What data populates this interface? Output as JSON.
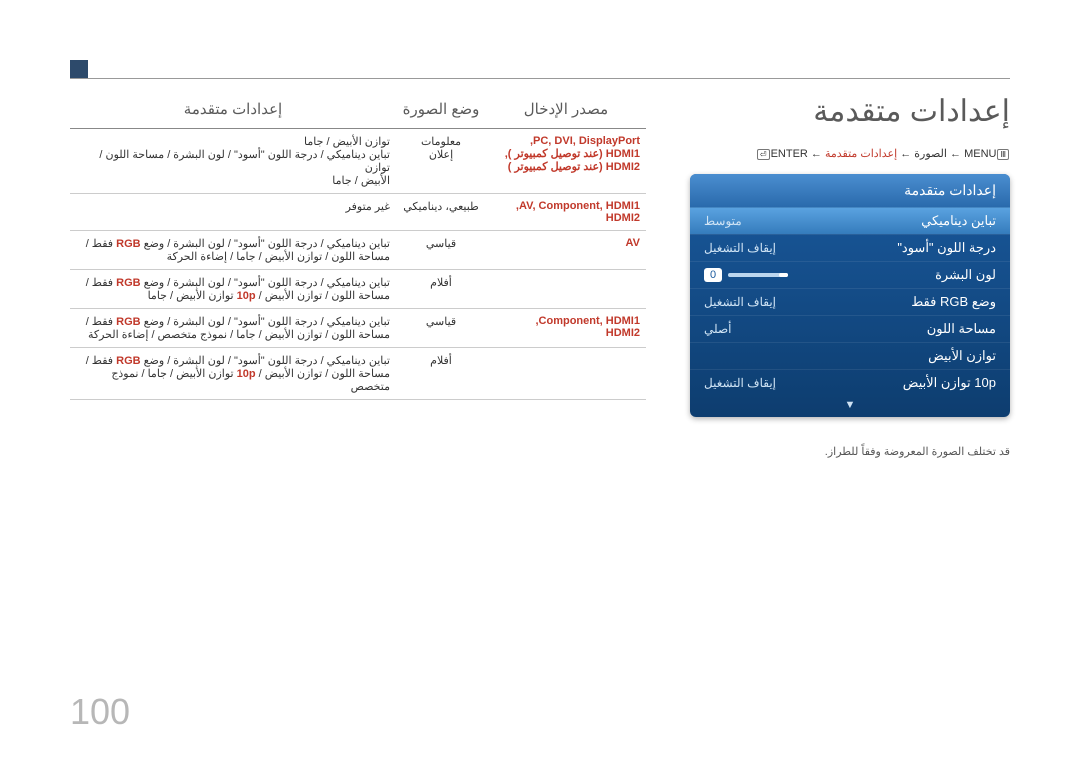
{
  "page_number": "100",
  "page_title": "إعدادات متقدمة",
  "breadcrumb": {
    "menu_label": "MENU",
    "picture_label": "الصورة",
    "advanced_label": "إعدادات متقدمة",
    "enter_label": "ENTER",
    "arrow": "←"
  },
  "osd": {
    "title": "إعدادات متقدمة",
    "rows": [
      {
        "label": "تباين ديناميكي",
        "value": "متوسط",
        "hl": true
      },
      {
        "label": "درجة اللون \"أسود\"",
        "value": "إيقاف التشغيل"
      },
      {
        "label": "لون البشرة",
        "value": "0",
        "slider": true
      },
      {
        "label": "وضع RGB فقط",
        "value": "إيقاف التشغيل"
      },
      {
        "label": "مساحة اللون",
        "value": "أصلي"
      },
      {
        "label": "توازن الأبيض",
        "value": ""
      },
      {
        "label": "10p توازن الأبيض",
        "value": "إيقاف التشغيل"
      }
    ]
  },
  "note": "قد تختلف الصورة المعروضة وفقاً للطراز.",
  "table": {
    "headers": [
      "مصدر الإدخال",
      "وضع الصورة",
      "إعدادات متقدمة"
    ],
    "rows": [
      {
        "source_lines": [
          "PC, DVI, DisplayPort,",
          "HDMI1 (عند توصيل كمبيوتر ),",
          "HDMI2 (عند توصيل كمبيوتر )"
        ],
        "mode_lines": [
          "معلومات",
          "إعلان"
        ],
        "settings_lines": [
          "توازن الأبيض / جاما",
          "تباين ديناميكي / درجة اللون \"أسود\" / لون البشرة / مساحة اللون / توازن",
          "الأبيض / جاما"
        ]
      },
      {
        "source_lines": [
          "AV, Component, HDMI1,",
          "HDMI2"
        ],
        "mode_lines": [
          "طبيعي، ديناميكي"
        ],
        "settings_lines": [
          "غير متوفر"
        ]
      },
      {
        "source_lines": [
          "AV"
        ],
        "mode_lines": [
          "قياسي"
        ],
        "settings_lines": [
          "تباين ديناميكي / درجة اللون \"أسود\" / لون البشرة / وضع RGB فقط / ",
          "مساحة اللون / توازن الأبيض / جاما / إضاءة الحركة"
        ]
      },
      {
        "source_lines": [
          ""
        ],
        "mode_lines": [
          "أفلام"
        ],
        "settings_lines": [
          "تباين ديناميكي / درجة اللون \"أسود\" / لون البشرة / وضع RGB فقط /",
          "مساحة اللون / توازن الأبيض / 10p توازن الأبيض / جاما"
        ]
      },
      {
        "source_lines": [
          "Component, HDMI1,",
          "HDMI2"
        ],
        "mode_lines": [
          "قياسي"
        ],
        "settings_lines": [
          "تباين ديناميكي / درجة اللون \"أسود\" / لون البشرة / وضع RGB فقط /",
          "مساحة اللون / توازن الأبيض / جاما / نموذج متخصص / إضاءة الحركة"
        ]
      },
      {
        "source_lines": [
          ""
        ],
        "mode_lines": [
          "أفلام"
        ],
        "settings_lines": [
          "تباين ديناميكي / درجة اللون \"أسود\" / لون البشرة / وضع RGB فقط /",
          "مساحة اللون / توازن الأبيض / 10p توازن الأبيض / جاما / نموذج متخصص"
        ]
      }
    ]
  }
}
